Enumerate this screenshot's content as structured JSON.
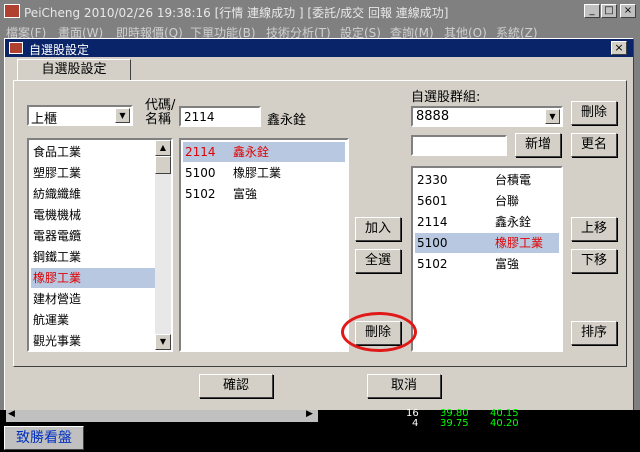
{
  "app": {
    "title": "PeiCheng 2010/02/26 19:38:16 [行情 連線成功 ] [委託/成交 回報 連線成功]",
    "min": "_",
    "max": "□",
    "close": "×",
    "menu": [
      "檔案(F)",
      "畫面(W)",
      "即時報價(Q)",
      "下單功能(B)",
      "技術分析(T)",
      "設定(S)",
      "查詢(M)",
      "其他(O)",
      "系統(Z)"
    ]
  },
  "dialog": {
    "title": "自選股設定",
    "close": "×",
    "tab": "自選股設定",
    "market": {
      "selected": "上櫃"
    },
    "code_label_1": "代碼/",
    "code_label_2": "名稱",
    "code_input": "2114",
    "code_name": "鑫永銓",
    "group_label": "自選股群組:",
    "group_selected": "8888",
    "new_group_input": "",
    "industries": [
      {
        "name": "食品工業"
      },
      {
        "name": "塑膠工業"
      },
      {
        "name": "紡織纖維"
      },
      {
        "name": "電機機械"
      },
      {
        "name": "電器電纜"
      },
      {
        "name": "鋼鐵工業"
      },
      {
        "name": "橡膠工業"
      },
      {
        "name": "建材營造"
      },
      {
        "name": "航運業"
      },
      {
        "name": "觀光事業"
      }
    ],
    "stocks": [
      {
        "code": "2114",
        "name": "鑫永銓"
      },
      {
        "code": "5100",
        "name": "橡膠工業"
      },
      {
        "code": "5102",
        "name": "富強"
      }
    ],
    "watchlist": [
      {
        "code": "2330",
        "name": "台積電"
      },
      {
        "code": "5601",
        "name": "台聯"
      },
      {
        "code": "2114",
        "name": "鑫永銓"
      },
      {
        "code": "5100",
        "name": "橡膠工業"
      },
      {
        "code": "5102",
        "name": "富強"
      }
    ],
    "buttons": {
      "delete_group": "刪除",
      "add_group": "新增",
      "rename_group": "更名",
      "add": "加入",
      "select_all": "全選",
      "remove": "刪除",
      "move_up": "上移",
      "move_down": "下移",
      "sort": "排序",
      "ok": "確認",
      "cancel": "取消"
    }
  },
  "taskbar": {
    "button": "致勝看盤"
  },
  "background_quote": {
    "v1": "16",
    "v2": "39.80",
    "v3": "40.15",
    "v4": "4",
    "v5": "39.75",
    "v6": "40.20"
  }
}
